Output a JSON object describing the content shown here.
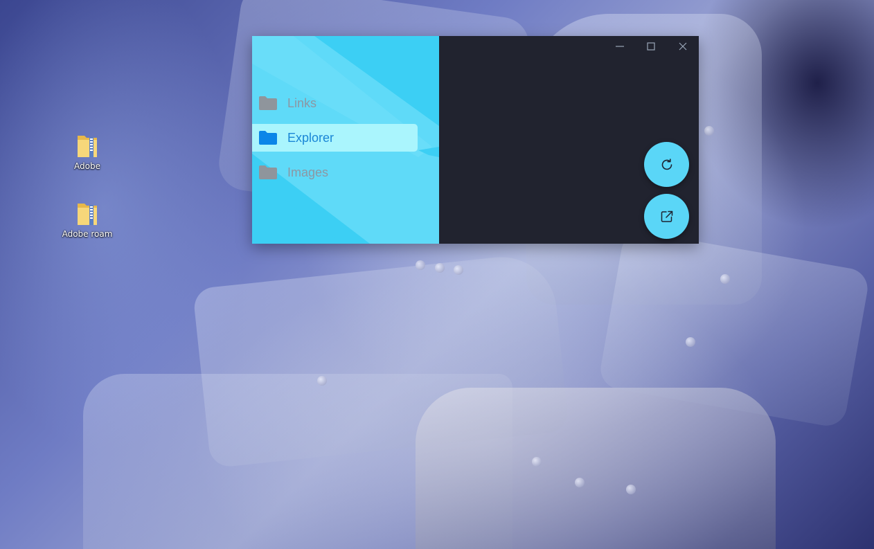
{
  "desktop": {
    "icons": [
      {
        "label": "Adobe",
        "icon": "folder-zip-icon"
      },
      {
        "label": "Adobe roam",
        "icon": "folder-zip-icon"
      }
    ]
  },
  "app": {
    "window_controls": {
      "minimize_icon": "minimize-icon",
      "maximize_icon": "maximize-icon",
      "close_icon": "close-icon"
    },
    "sidebar": {
      "items": [
        {
          "label": "Links",
          "icon": "folder-icon",
          "active": false
        },
        {
          "label": "Explorer",
          "icon": "folder-icon",
          "active": true
        },
        {
          "label": "Images",
          "icon": "folder-icon",
          "active": false
        }
      ]
    },
    "actions": {
      "refresh_icon": "refresh-icon",
      "open_external_icon": "open-external-icon"
    },
    "colors": {
      "sidebar_bg": "#3ccff4",
      "active_item_bg": "#aaf5fd",
      "active_text": "#1a86d6",
      "inactive_text": "#8c97a3",
      "content_bg": "#21232f",
      "fab_bg": "#5ad6f7"
    }
  }
}
